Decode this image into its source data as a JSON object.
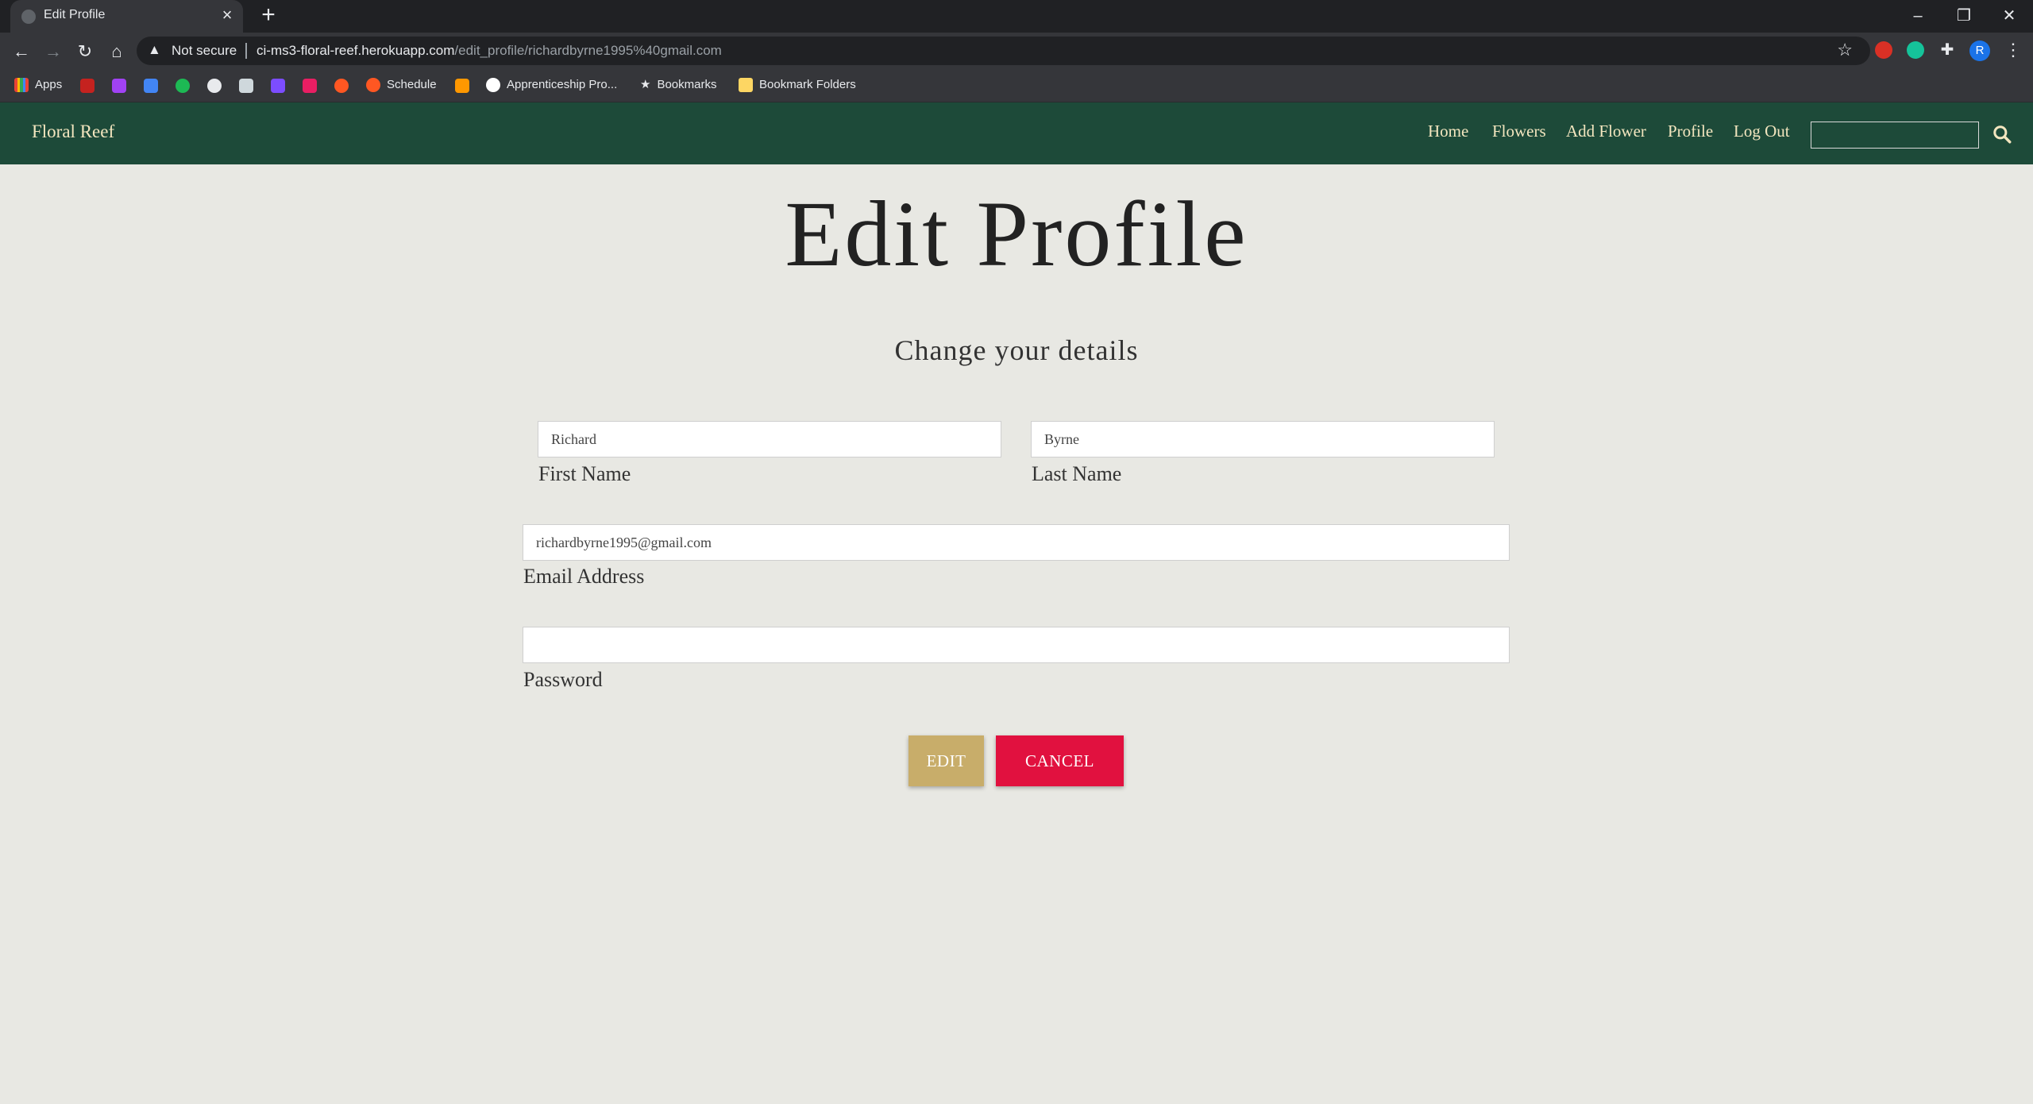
{
  "browser": {
    "tab_title": "Edit Profile",
    "security_label": "Not secure",
    "url_host": "ci-ms3-floral-reef.herokuapp.com",
    "url_path": "/edit_profile/richardbyrne1995%40gmail.com",
    "profile_initial": "R",
    "bookmarks": {
      "apps": "Apps",
      "schedule": "Schedule",
      "apprenticeship": "Apprenticeship Pro...",
      "bookmarks": "Bookmarks",
      "bookmark_folders": "Bookmark Folders"
    }
  },
  "navbar": {
    "brand": "Floral Reef",
    "links": {
      "home": "Home",
      "flowers": "Flowers",
      "add_flower": "Add Flower",
      "profile": "Profile",
      "logout": "Log Out"
    },
    "colors": {
      "background": "#1d4a39",
      "text": "#f3e6bf"
    }
  },
  "page": {
    "title": "Edit Profile",
    "subtitle": "Change your details"
  },
  "form": {
    "first_name": {
      "value": "Richard",
      "label": "First Name"
    },
    "last_name": {
      "value": "Byrne",
      "label": "Last Name"
    },
    "email": {
      "value": "richardbyrne1995@gmail.com",
      "label": "Email Address"
    },
    "password": {
      "value": "",
      "label": "Password"
    },
    "edit_label": "Edit",
    "cancel_label": "Cancel",
    "colors": {
      "edit": "#c8ad6a",
      "cancel": "#e1113f"
    }
  }
}
